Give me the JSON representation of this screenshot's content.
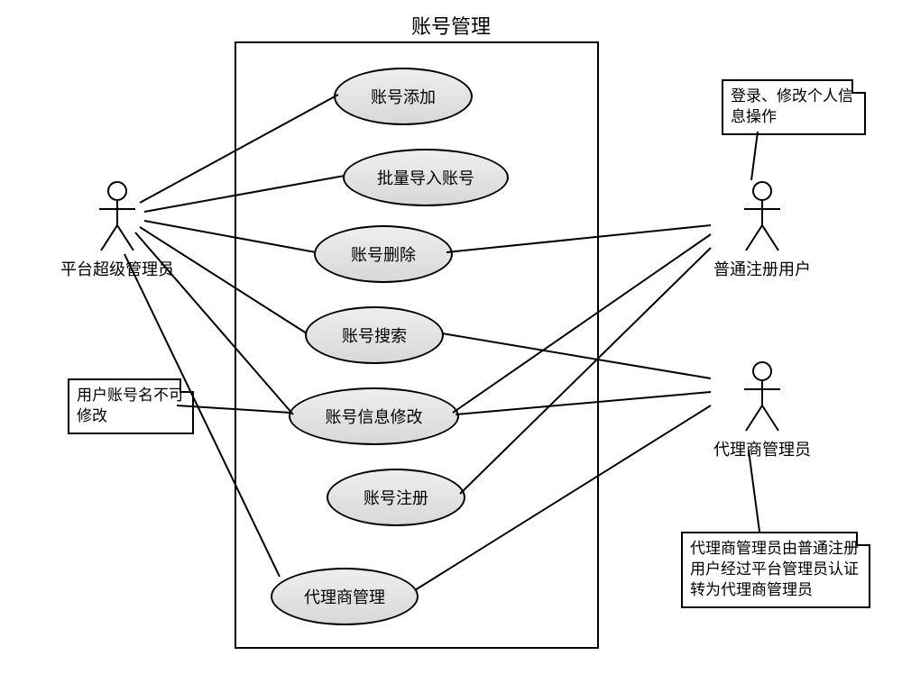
{
  "title": "账号管理",
  "actors": {
    "super_admin": "平台超级管理员",
    "normal_user": "普通注册用户",
    "agent_admin": "代理商管理员"
  },
  "usecases": {
    "add": "账号添加",
    "import": "批量导入账号",
    "delete": "账号删除",
    "search": "账号搜索",
    "modify": "账号信息修改",
    "register": "账号注册",
    "agent_mgmt": "代理商管理"
  },
  "notes": {
    "login_edit": "登录、修改个人信息操作",
    "username_lock": "用户账号名不可修改",
    "agent_cert": "代理商管理员由普通注册用户经过平台管理员认证转为代理商管理员"
  }
}
